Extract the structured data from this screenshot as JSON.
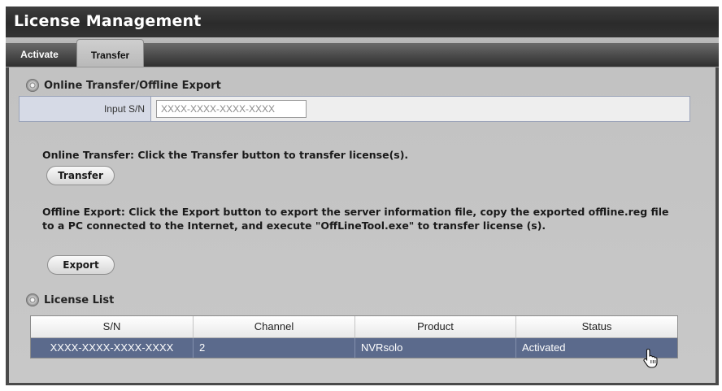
{
  "window": {
    "title": "License Management"
  },
  "tabs": [
    {
      "label": "Activate",
      "active": false
    },
    {
      "label": "Transfer",
      "active": true
    }
  ],
  "transfer_section": {
    "heading": "Online Transfer/Offline Export",
    "sn_label": "Input S/N",
    "sn_value": "",
    "sn_placeholder": "XXXX-XXXX-XXXX-XXXX",
    "online_text": "Online Transfer: Click the Transfer button to transfer license(s).",
    "transfer_button": "Transfer",
    "offline_text": "Offline Export: Click the Export button to export the server information file, copy the exported offline.reg file to a PC connected to the Internet, and execute \"OffLineTool.exe\" to transfer license (s).",
    "export_button": "Export"
  },
  "license_list": {
    "heading": "License List",
    "columns": [
      "S/N",
      "Channel",
      "Product",
      "Status"
    ],
    "rows": [
      {
        "sn": "XXXX-XXXX-XXXX-XXXX",
        "channel": "2",
        "product": "NVRsolo",
        "status": "Activated"
      }
    ]
  },
  "colors": {
    "title_bar": "#2b2b2b",
    "panel": "#c4c4c4",
    "selected_row": "#5b6a8c",
    "label_cell": "#d6dae6"
  },
  "icons": {
    "section_icon": "disc-icon",
    "cursor": "hand-pointer-icon"
  }
}
